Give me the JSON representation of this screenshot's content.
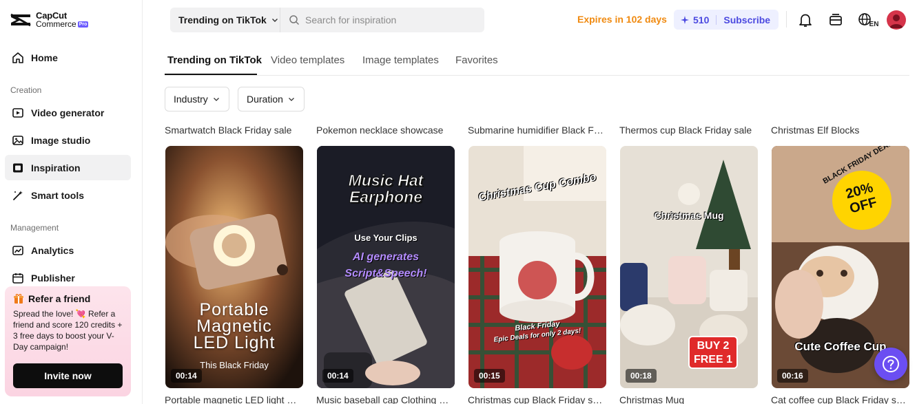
{
  "brand": {
    "line1": "CapCut",
    "line2": "Commerce",
    "badge": "Pro"
  },
  "sidebar": {
    "home": "Home",
    "creation_label": "Creation",
    "creation_items": [
      "Video generator",
      "Image studio",
      "Inspiration",
      "Smart tools"
    ],
    "management_label": "Management",
    "management_items": [
      "Analytics",
      "Publisher"
    ]
  },
  "refer": {
    "title": "Refer a friend",
    "text": "Spread the love! 💘 Refer a friend and score 120 credits + 3 free days to boost your V-Day campaign!",
    "button": "Invite now"
  },
  "header": {
    "source_select": "Trending on TikTok",
    "search_placeholder": "Search for inspiration",
    "expires": "Expires in 102 days",
    "credits": "510",
    "subscribe": "Subscribe",
    "language": "EN"
  },
  "tabs": [
    "Trending on TikTok",
    "Video templates",
    "Image templates",
    "Favorites"
  ],
  "filters": [
    "Industry",
    "Duration"
  ],
  "cards": [
    {
      "title": "Smartwatch Black Friday sale",
      "caption": "Portable magnetic LED light …",
      "duration": "00:14",
      "overlay": [
        "Portable",
        "Magnetic",
        "LED Light"
      ],
      "sub": "This Black Friday"
    },
    {
      "title": "Pokemon necklace showcase",
      "caption": "Music baseball cap Clothing …",
      "duration": "00:14",
      "overlay": [
        "Music Hat",
        "Earphone"
      ],
      "sub": "Use Your Clips",
      "sub2": [
        "AI generates",
        "Script&Speech!"
      ]
    },
    {
      "title": "Submarine humidifier Black F…",
      "caption": "Christmas cup Black Friday s…",
      "duration": "00:15",
      "overlay": [
        "Christmas Cup Combo"
      ],
      "sub": "Black Friday",
      "sub2": [
        "Epic Deals for only 2 days!"
      ]
    },
    {
      "title": "Thermos cup Black Friday sale",
      "caption": "Christmas Mug",
      "duration": "00:18",
      "overlay": [
        "Christmas Mug"
      ],
      "sub": "BUY 2",
      "sub2": [
        "FREE 1"
      ]
    },
    {
      "title": "Christmas Elf Blocks",
      "caption": "Cat coffee cup Black Friday s…",
      "duration": "00:16",
      "overlay": [
        "Cute Coffee Cup"
      ],
      "sub": "BLACK FRIDAY DEAL",
      "sub2": [
        "20%",
        "OFF"
      ]
    }
  ],
  "colors": {
    "accent": "#4b49e0",
    "expires": "#f08a10",
    "help": "#6b4ef2"
  }
}
